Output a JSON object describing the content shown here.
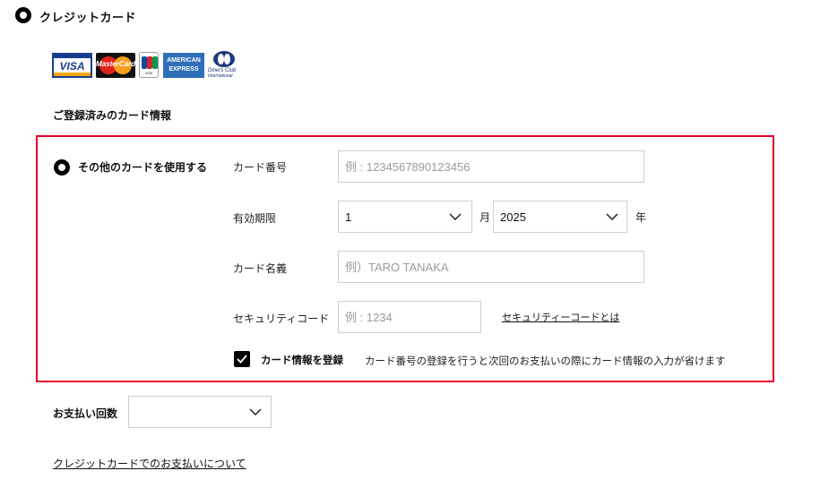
{
  "header": {
    "title": "クレジットカード"
  },
  "brands": {
    "visa_text": "VISA",
    "mastercard_text": "MasterCard",
    "jcb_text": "JCB",
    "amex_line1": "AMERICAN",
    "amex_line2": "EXPRESS",
    "diners_line1": "Diners Club",
    "diners_line2": "International",
    "colors": {
      "visa": "#1a3e8f",
      "mastercard_red": "#e2231a",
      "mastercard_orange": "#f79e1b",
      "amex": "#2f6fb7",
      "diners": "#1b3a7a",
      "jcb_blue": "#0b4ea2",
      "jcb_red": "#d8232a",
      "jcb_green": "#009a4e"
    }
  },
  "registered_heading": "ご登録済みのカード情報",
  "other_card": {
    "option_label": "その他のカードを使用する",
    "card_number": {
      "label": "カード番号",
      "placeholder": "例 : 1234567890123456",
      "value": ""
    },
    "expiry": {
      "label": "有効期限",
      "month_value": "1",
      "month_unit": "月",
      "year_value": "2025",
      "year_unit": "年"
    },
    "card_name": {
      "label": "カード名義",
      "placeholder": "例）TARO TANAKA",
      "value": ""
    },
    "security_code": {
      "label": "セキュリティコード",
      "placeholder": "例 : 1234",
      "value": "",
      "help_link": "セキュリティーコードとは"
    },
    "save_card": {
      "label": "カード情報を登録",
      "checked": true,
      "description": "カード番号の登録を行うと次回のお支払いの際にカード情報の入力が省けます"
    },
    "highlight_color": "#e4002b"
  },
  "installments": {
    "label": "お支払い回数",
    "value": ""
  },
  "footer_link": "クレジットカードでのお支払いについて"
}
